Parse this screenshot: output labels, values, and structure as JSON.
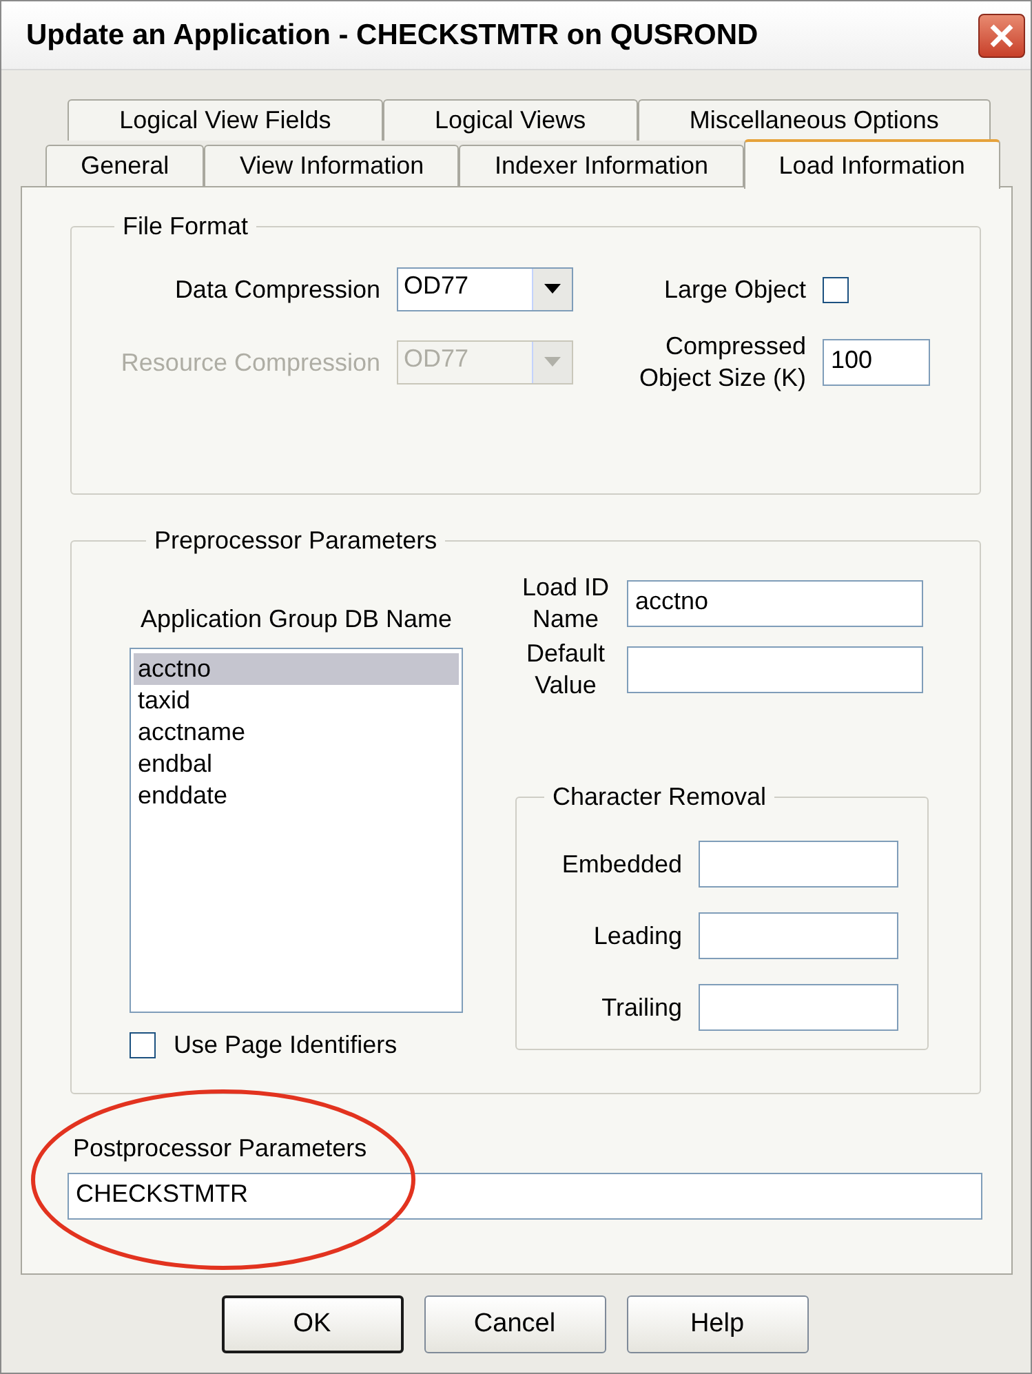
{
  "window": {
    "title": "Update an Application - CHECKSTMTR on QUSROND"
  },
  "tab_rows": [
    [
      {
        "label": "Logical View Fields",
        "selected": false
      },
      {
        "label": "Logical Views",
        "selected": false
      },
      {
        "label": "Miscellaneous Options",
        "selected": false
      }
    ],
    [
      {
        "label": "General",
        "selected": false
      },
      {
        "label": "View Information",
        "selected": false
      },
      {
        "label": "Indexer Information",
        "selected": false
      },
      {
        "label": "Load Information",
        "selected": true
      }
    ]
  ],
  "file_format": {
    "title": "File Format",
    "data_compression": {
      "label": "Data Compression",
      "value": "OD77",
      "disabled": false
    },
    "resource_compression": {
      "label": "Resource Compression",
      "value": "OD77",
      "disabled": true
    },
    "large_object": {
      "label": "Large Object",
      "checked": false
    },
    "compressed_object_size": {
      "label": "Compressed Object Size (K)",
      "value": "100"
    }
  },
  "preprocessor": {
    "title": "Preprocessor Parameters",
    "list": {
      "label": "Application Group DB Name",
      "items": [
        {
          "text": "acctno",
          "selected": true
        },
        {
          "text": "taxid",
          "selected": false
        },
        {
          "text": "acctname",
          "selected": false
        },
        {
          "text": "endbal",
          "selected": false
        },
        {
          "text": "enddate",
          "selected": false
        }
      ]
    },
    "use_page_identifiers": {
      "label": "Use Page Identifiers",
      "checked": false
    },
    "load_id_name": {
      "label": "Load ID Name",
      "value": "acctno"
    },
    "default_value": {
      "label": "Default Value"
    },
    "character_removal": {
      "title": "Character Removal",
      "fields": [
        {
          "label": "Embedded"
        },
        {
          "label": "Leading"
        },
        {
          "label": "Trailing"
        }
      ]
    }
  },
  "postprocessor": {
    "label": "Postprocessor Parameters",
    "value": "CHECKSTMTR"
  },
  "buttons": [
    {
      "label": "OK",
      "default": true
    },
    {
      "label": "Cancel",
      "default": false
    },
    {
      "label": "Help",
      "default": false
    }
  ]
}
